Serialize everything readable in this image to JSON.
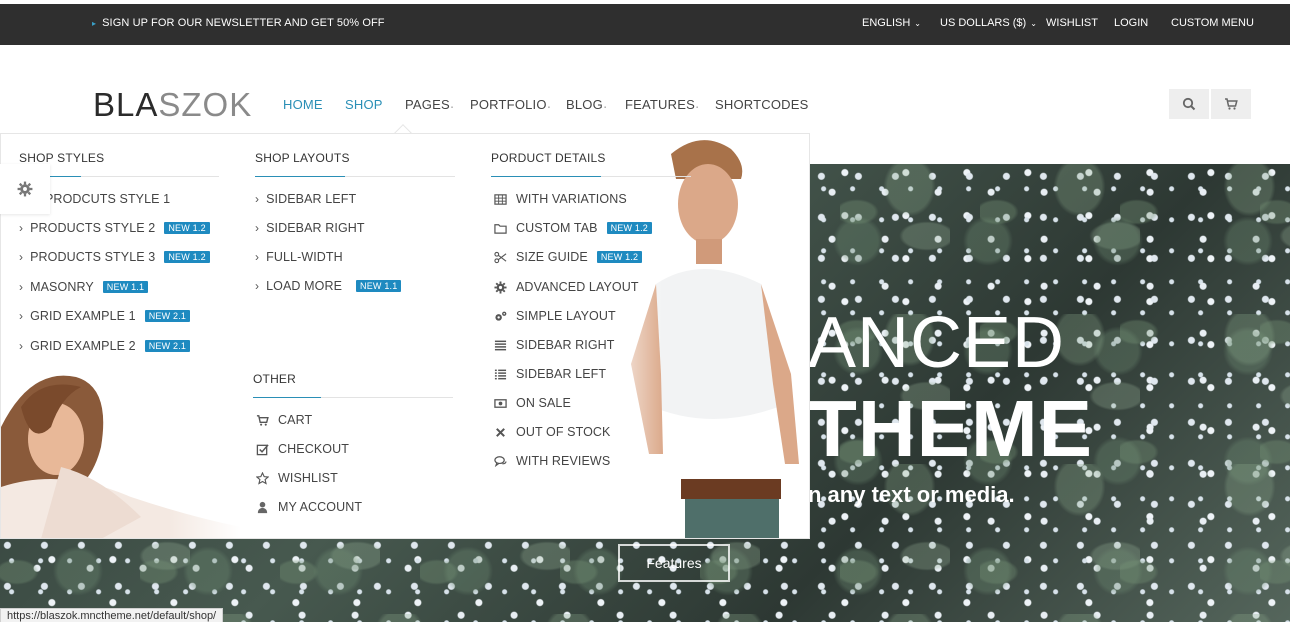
{
  "topbar": {
    "promo": "SIGN UP FOR OUR NEWSLETTER AND GET 50% OFF",
    "language": "ENGLISH",
    "currency": "US DOLLARS ($)",
    "wishlist": "WISHLIST",
    "login": "LOGIN",
    "custom_menu": "CUSTOM MENU"
  },
  "logo": {
    "dark": "BLA",
    "light": "SZOK"
  },
  "nav": {
    "items": [
      {
        "label": "HOME"
      },
      {
        "label": "SHOP"
      },
      {
        "label": "PAGES"
      },
      {
        "label": "PORTFOLIO"
      },
      {
        "label": "BLOG"
      },
      {
        "label": "FEATURES"
      },
      {
        "label": "SHORTCODES"
      }
    ]
  },
  "header_icons": [
    "search-icon",
    "cart-icon"
  ],
  "mega_menu": {
    "shop_styles": {
      "title": "SHOP STYLES",
      "items": [
        {
          "label": "PRODCUTS STYLE 1",
          "badge": ""
        },
        {
          "label": "PRODUCTS STYLE 2",
          "badge": "NEW 1.2"
        },
        {
          "label": "PRODUCTS STYLE 3",
          "badge": "NEW 1.2"
        },
        {
          "label": "MASONRY",
          "badge": "NEW 1.1"
        },
        {
          "label": "GRID EXAMPLE 1",
          "badge": "NEW 2.1"
        },
        {
          "label": "GRID EXAMPLE 2",
          "badge": "NEW 2.1"
        }
      ]
    },
    "shop_layouts": {
      "title": "SHOP LAYOUTS",
      "items": [
        {
          "label": "SIDEBAR LEFT",
          "badge": ""
        },
        {
          "label": "SIDEBAR RIGHT",
          "badge": ""
        },
        {
          "label": "FULL-WIDTH",
          "badge": ""
        },
        {
          "label": "LOAD MORE",
          "badge": "NEW 1.1"
        }
      ]
    },
    "other": {
      "title": "OTHER",
      "items": [
        {
          "label": "CART",
          "icon": "cart-icon"
        },
        {
          "label": "CHECKOUT",
          "icon": "checkbox-icon"
        },
        {
          "label": "WISHLIST",
          "icon": "star-icon"
        },
        {
          "label": "MY ACCOUNT",
          "icon": "user-icon"
        }
      ]
    },
    "product_details": {
      "title": "PORDUCT DETAILS",
      "items": [
        {
          "label": "WITH VARIATIONS",
          "icon": "table-icon",
          "badge": ""
        },
        {
          "label": "CUSTOM TAB",
          "icon": "folder-icon",
          "badge": "NEW 1.2"
        },
        {
          "label": "SIZE GUIDE",
          "icon": "scissors-icon",
          "badge": "NEW 1.2"
        },
        {
          "label": "ADVANCED LAYOUT",
          "icon": "gear-icon",
          "badge": ""
        },
        {
          "label": "SIMPLE LAYOUT",
          "icon": "gears-icon",
          "badge": ""
        },
        {
          "label": "SIDEBAR RIGHT",
          "icon": "align-right-icon",
          "badge": ""
        },
        {
          "label": "SIDEBAR LEFT",
          "icon": "list-icon",
          "badge": ""
        },
        {
          "label": "ON SALE",
          "icon": "money-icon",
          "badge": ""
        },
        {
          "label": "OUT OF STOCK",
          "icon": "close-icon",
          "badge": ""
        },
        {
          "label": "WITH REVIEWS",
          "icon": "comments-icon",
          "badge": ""
        }
      ]
    }
  },
  "hero": {
    "title_line1": "ANCED",
    "title_line2": "THEME",
    "subtitle": "n any text or media.",
    "button": "Features"
  },
  "status_bar": "https://blaszok.mnctheme.net/default/shop/",
  "colors": {
    "accent": "#2a8fb6",
    "badge": "#1e8ac0",
    "topbar": "#2f2f2f"
  }
}
